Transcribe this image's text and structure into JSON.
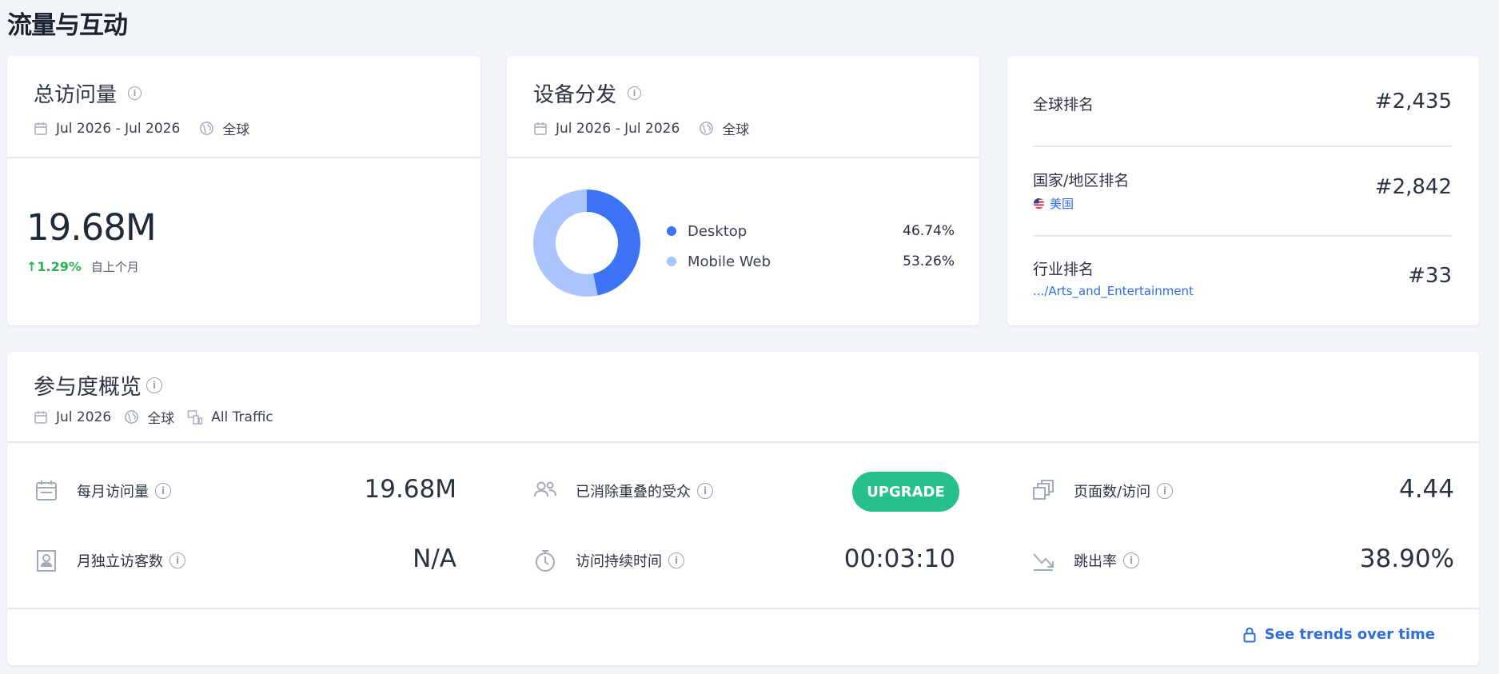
{
  "section_title": "流量与互动",
  "total_visits": {
    "title": "总访问量",
    "date_range": "Jul 2026 - Jul 2026",
    "region": "全球",
    "value": "19.68M",
    "change": "↑1.29%",
    "change_label": "自上个月"
  },
  "device_distribution": {
    "title": "设备分发",
    "date_range": "Jul 2026 - Jul 2026",
    "region": "全球",
    "items": [
      {
        "label": "Desktop",
        "value": "46.74%",
        "share": 46.74,
        "color": "#3d74f5"
      },
      {
        "label": "Mobile Web",
        "value": "53.26%",
        "share": 53.26,
        "color": "#a9c5fb"
      }
    ]
  },
  "ranks": {
    "global": {
      "label": "全球排名",
      "value": "#2,435"
    },
    "country": {
      "label": "国家/地区排名",
      "sub": "美国",
      "value": "#2,842"
    },
    "industry": {
      "label": "行业排名",
      "sub": ".../Arts_and_Entertainment",
      "value": "#33"
    }
  },
  "engagement": {
    "title": "参与度概览",
    "date": "Jul 2026",
    "region": "全球",
    "traffic": "All Traffic",
    "metrics": {
      "monthly_visits": {
        "label": "每月访问量",
        "value": "19.68M"
      },
      "dedup_audience": {
        "label": "已消除重叠的受众",
        "button": "UPGRADE"
      },
      "pages_per_visit": {
        "label": "页面数/访问",
        "value": "4.44"
      },
      "unique_visitors": {
        "label": "月独立访客数",
        "value": "N/A"
      },
      "visit_duration": {
        "label": "访问持续时间",
        "value": "00:03:10"
      },
      "bounce_rate": {
        "label": "跳出率",
        "value": "38.90%"
      }
    },
    "trends_link": "See trends over time"
  },
  "colors": {
    "accent": "#2f6de1",
    "positive": "#2cb356",
    "upgrade": "#26bf8d"
  }
}
